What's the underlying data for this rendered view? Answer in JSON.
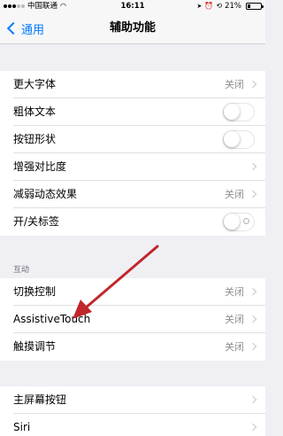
{
  "status_bar": {
    "carrier": "中国联通",
    "time": "16:11",
    "battery": "21%"
  },
  "nav": {
    "back_label": "通用",
    "title": "辅助功能"
  },
  "group1": {
    "larger_text": {
      "label": "更大字体",
      "value": "关闭"
    },
    "bold_text": {
      "label": "粗体文本",
      "on": false
    },
    "button_shapes": {
      "label": "按钮形状",
      "on": false
    },
    "increase_contrast": {
      "label": "增强对比度"
    },
    "reduce_motion": {
      "label": "减弱动态效果",
      "value": "关闭"
    },
    "on_off_labels": {
      "label": "开/关标签",
      "on": false
    }
  },
  "interaction": {
    "header": "互动",
    "switch_control": {
      "label": "切换控制",
      "value": "关闭"
    },
    "assistive_touch": {
      "label": "AssistiveTouch",
      "value": "关闭"
    },
    "touch_accommodations": {
      "label": "触摸调节",
      "value": "关闭"
    }
  },
  "group3": {
    "home_button": {
      "label": "主屏幕按钮"
    },
    "siri": {
      "label": "Siri"
    }
  },
  "annotation": {
    "arrow_color": "#c0262a"
  }
}
